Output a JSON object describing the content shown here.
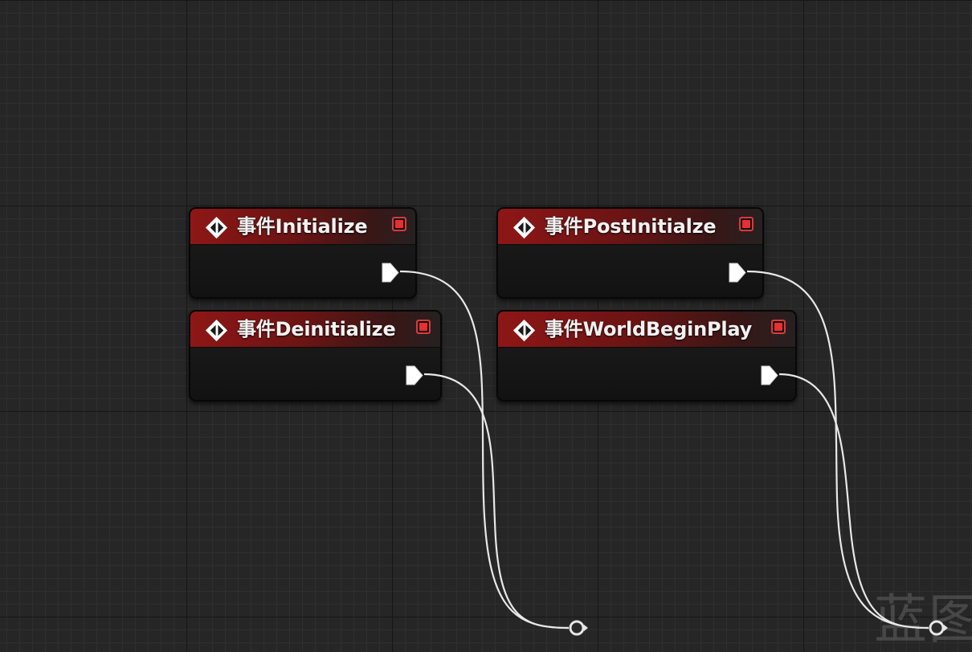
{
  "graph": {
    "nodes": [
      {
        "id": "initialize",
        "title": "事件Initialize"
      },
      {
        "id": "post-initialize",
        "title": "事件PostInitialze"
      },
      {
        "id": "deinitialize",
        "title": "事件Deinitialize"
      },
      {
        "id": "world-begin-play",
        "title": "事件WorldBeginPlay"
      }
    ],
    "node_header_color": "#8e1616",
    "event_icon": "event-diamond-icon",
    "delegate_pin_icon": "delegate-square-icon",
    "exec_pin_icon": "exec-arrow-icon",
    "wire_color": "#ffffff"
  },
  "watermark": {
    "text": "蓝图"
  }
}
